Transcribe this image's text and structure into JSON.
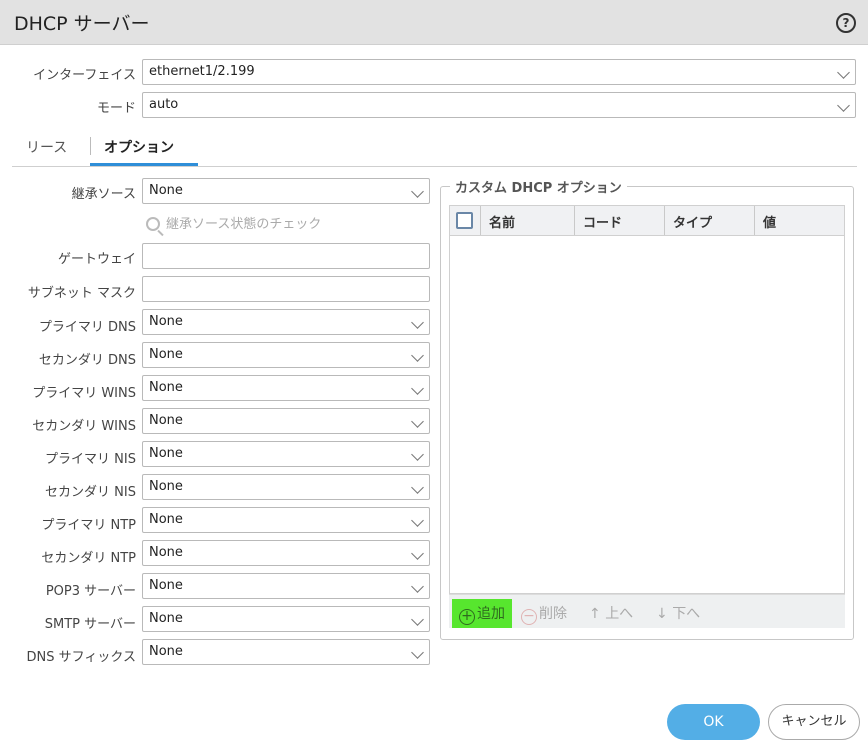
{
  "dialog": {
    "title": "DHCP サーバー",
    "help_glyph": "?"
  },
  "top_fields": [
    {
      "label": "インターフェイス",
      "value": "ethernet1/2.199"
    },
    {
      "label": "モード",
      "value": "auto"
    }
  ],
  "tabs": [
    {
      "label": "リース",
      "active": false
    },
    {
      "label": "オプション",
      "active": true
    }
  ],
  "options": {
    "inherit_source": {
      "label": "継承ソース",
      "value": "None"
    },
    "check_link": "継承ソース状態のチェック",
    "gateway": {
      "label": "ゲートウェイ",
      "value": ""
    },
    "subnet_mask": {
      "label": "サブネット マスク",
      "value": ""
    },
    "selects": [
      {
        "label": "プライマリ DNS",
        "value": "None"
      },
      {
        "label": "セカンダリ DNS",
        "value": "None"
      },
      {
        "label": "プライマリ WINS",
        "value": "None"
      },
      {
        "label": "セカンダリ WINS",
        "value": "None"
      },
      {
        "label": "プライマリ NIS",
        "value": "None"
      },
      {
        "label": "セカンダリ NIS",
        "value": "None"
      },
      {
        "label": "プライマリ NTP",
        "value": "None"
      },
      {
        "label": "セカンダリ NTP",
        "value": "None"
      },
      {
        "label": "POP3 サーバー",
        "value": "None"
      },
      {
        "label": "SMTP サーバー",
        "value": "None"
      },
      {
        "label": "DNS サフィックス",
        "value": "None"
      }
    ]
  },
  "custom_options": {
    "legend": "カスタム DHCP オプション",
    "columns": [
      "名前",
      "コード",
      "タイプ",
      "値"
    ],
    "rows": [],
    "toolbar": {
      "add": "追加",
      "delete": "削除",
      "up": "上へ",
      "down": "下へ"
    }
  },
  "footer": {
    "ok": "OK",
    "cancel": "キャンセル"
  },
  "colors": {
    "titlebar": "#e2e2e2",
    "tab_underline": "#2f8ed8",
    "ok_button": "#53aee6",
    "add_highlight": "#57e62e"
  }
}
